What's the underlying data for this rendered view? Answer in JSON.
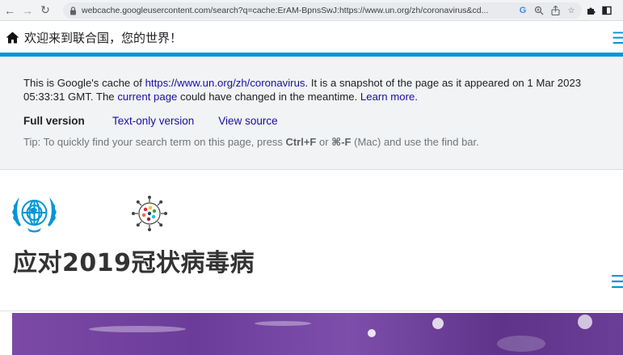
{
  "browser": {
    "url": "webcache.googleusercontent.com/search?q=cache:ErAM-BpnsSwJ:https://www.un.org/zh/coronavirus&cd...",
    "icons": [
      "back-icon",
      "forward-icon",
      "reload-icon",
      "lock-icon",
      "google-lens-icon",
      "zoom-icon",
      "share-icon",
      "star-icon",
      "extensions-icon",
      "sidebar-icon"
    ],
    "g_label": "G"
  },
  "un_header": {
    "welcome": "欢迎来到联合国，您的世界！"
  },
  "cache_notice": {
    "prefix": "This is Google's cache of ",
    "cached_url": "https://www.un.org/zh/coronavirus",
    "middle": ". It is a snapshot of the page as it appeared on 1 Mar 2023 05:33:31 GMT. The ",
    "current_page": "current page",
    "suffix": " could have changed in the meantime. ",
    "learn_more": "Learn more.",
    "full_version": "Full version",
    "text_only": "Text-only version",
    "view_source": "View source",
    "tip_prefix": "Tip: To quickly find your search term on this page, press ",
    "tip_key1": "Ctrl+F",
    "tip_or": " or ",
    "tip_key2": "⌘-F",
    "tip_suffix": " (Mac) and use the find bar."
  },
  "page": {
    "title": "应对2019冠状病毒病"
  },
  "colors": {
    "un_blue": "#0097d6",
    "link": "#1a0dab",
    "hero_purple": "#6c3c9a"
  }
}
